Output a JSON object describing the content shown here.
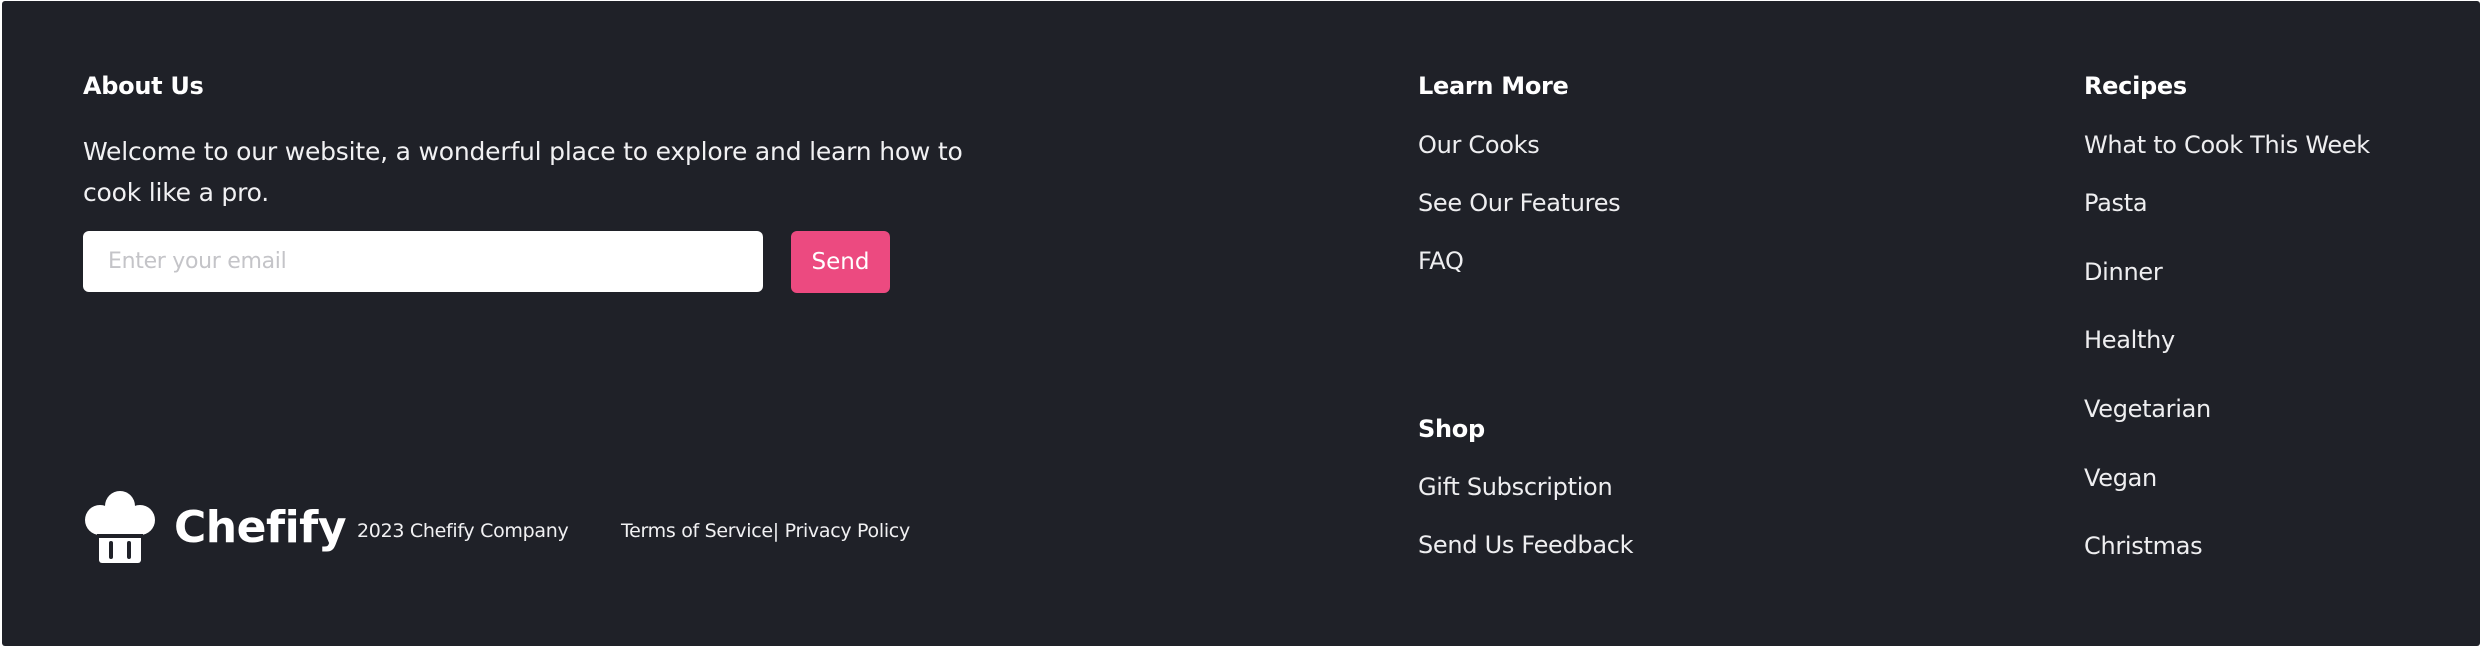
{
  "about": {
    "heading": "About Us",
    "description": "Welcome to our website, a wonderful place to explore and learn how to cook like a pro.",
    "email_placeholder": "Enter your email",
    "send_label": "Send"
  },
  "brand": {
    "name": "Chefify",
    "copyright": "2023 Chefify Company",
    "terms": "Terms of Service|",
    "privacy": " Privacy Policy"
  },
  "learn_more": {
    "heading": "Learn More",
    "links": [
      "Our Cooks",
      "See Our Features",
      "FAQ"
    ]
  },
  "shop": {
    "heading": "Shop",
    "links": [
      "Gift Subscription",
      "Send Us Feedback"
    ]
  },
  "recipes": {
    "heading": "Recipes",
    "links": [
      "What to Cook This Week",
      "Pasta",
      "Dinner",
      "Healthy",
      "Vegetarian",
      "Vegan",
      "Christmas"
    ]
  },
  "colors": {
    "background": "#1f2128",
    "accent": "#ec4a80",
    "text": "#ffffff"
  },
  "icons": {
    "logo": "chef-hat-icon"
  }
}
